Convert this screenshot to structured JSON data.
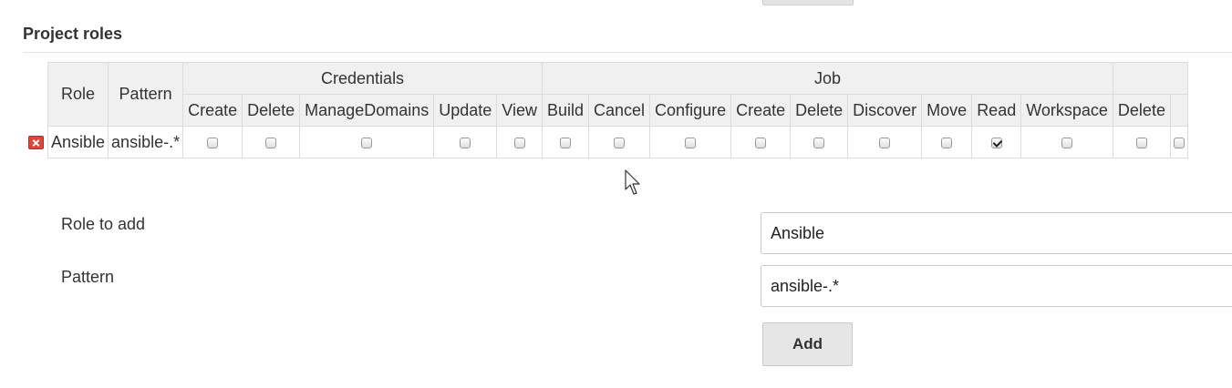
{
  "section_title": "Project roles",
  "table": {
    "headers": {
      "role": "Role",
      "pattern": "Pattern"
    },
    "groups": [
      {
        "label": "Credentials"
      },
      {
        "label": "Job"
      },
      {
        "label": ""
      }
    ],
    "permissions": [
      "Create",
      "Delete",
      "ManageDomains",
      "Update",
      "View",
      "Build",
      "Cancel",
      "Configure",
      "Create",
      "Delete",
      "Discover",
      "Move",
      "Read",
      "Workspace",
      "Delete",
      ""
    ],
    "rows": [
      {
        "role": "Ansible",
        "pattern": "ansible-.*",
        "checked": [
          false,
          false,
          false,
          false,
          false,
          false,
          false,
          false,
          false,
          false,
          false,
          false,
          true,
          false,
          false,
          false
        ]
      }
    ]
  },
  "form": {
    "role_label": "Role to add",
    "role_value": "Ansible",
    "pattern_label": "Pattern",
    "pattern_value": "ansible-.*",
    "add_label": "Add"
  }
}
